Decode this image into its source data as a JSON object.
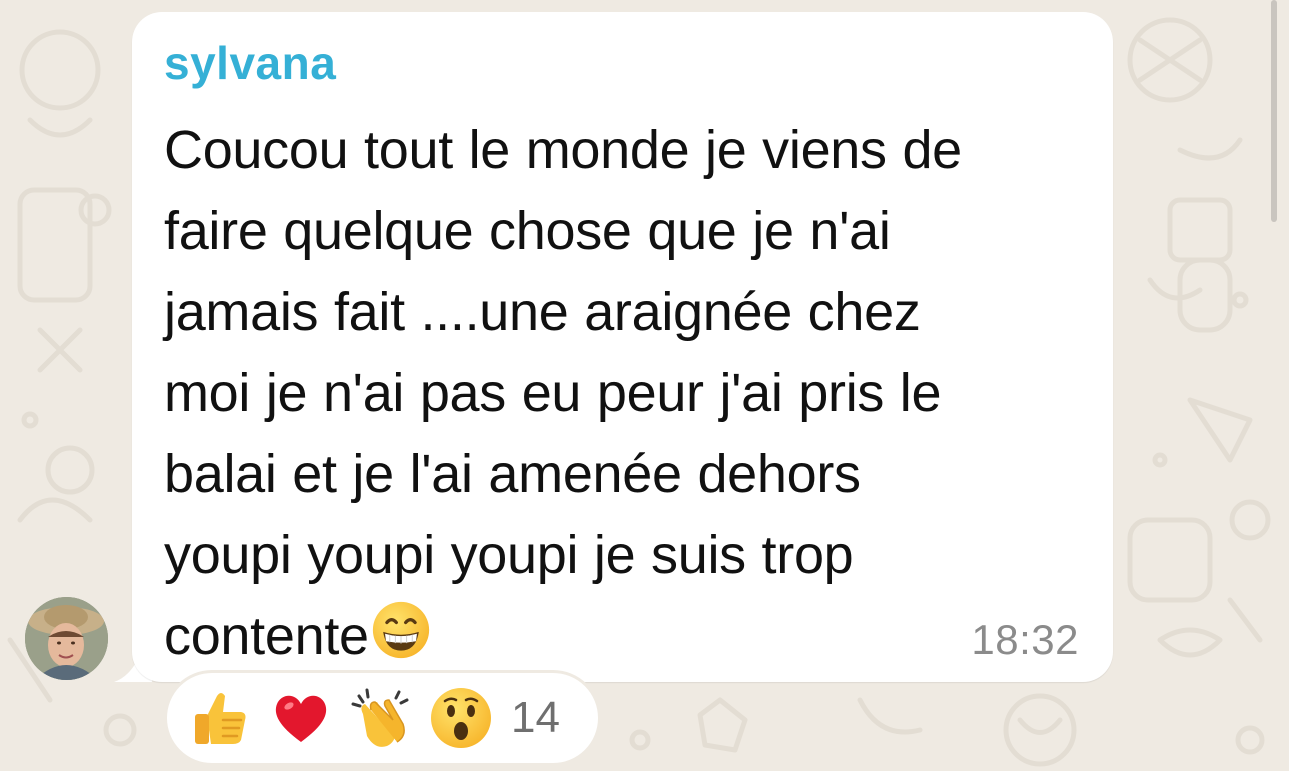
{
  "message": {
    "sender": "sylvana",
    "lines": [
      "Coucou tout le monde je viens de",
      "faire quelque chose que je n'ai",
      "jamais fait ....une araignée chez",
      "moi je n'ai pas eu peur j'ai pris le",
      "balai et je l'ai amenée dehors",
      "youpi youpi youpi je suis trop",
      "contente"
    ],
    "trailing_emoji": "grinning-face-with-smiling-eyes",
    "time": "18:32"
  },
  "reactions": {
    "items": [
      {
        "icon": "thumbs-up-icon"
      },
      {
        "icon": "red-heart-icon"
      },
      {
        "icon": "clapping-hands-icon"
      },
      {
        "icon": "surprised-face-icon"
      }
    ],
    "count": "14"
  },
  "colors": {
    "background": "#efeae2",
    "bubble": "#ffffff",
    "sender": "#35b0d6",
    "text": "#111111",
    "timestamp": "#8b8b8b"
  }
}
